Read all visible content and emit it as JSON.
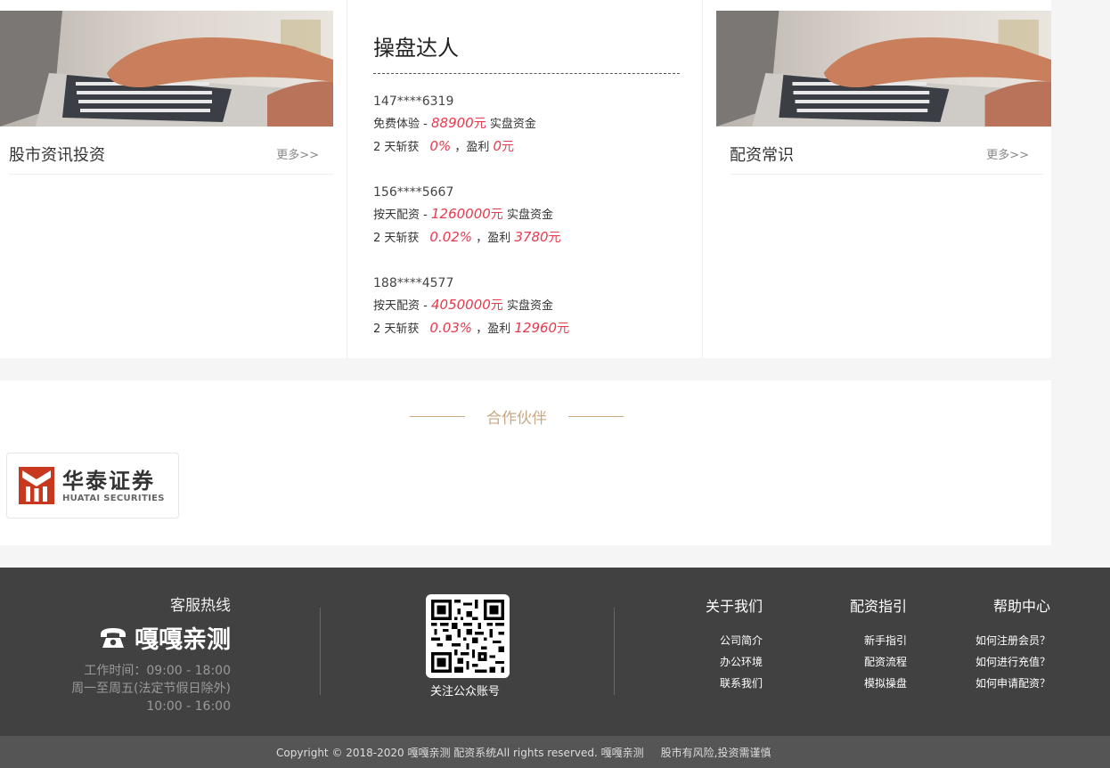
{
  "left_column": {
    "title": "股市资讯投资",
    "more": "更多>>"
  },
  "right_column": {
    "title": "配资常识",
    "more": "更多>>"
  },
  "experts": {
    "title": "操盘达人",
    "trades": [
      {
        "phone": "147****6319",
        "type": "免费体验",
        "amount": "88900",
        "unit": "元",
        "amount_suffix": "实盘资金",
        "days": "2 天斩获",
        "rate": "0%",
        "profit_label": "，盈利",
        "profit": "0",
        "profit_unit": "元"
      },
      {
        "phone": "156****5667",
        "type": "按天配资",
        "amount": "1260000",
        "unit": "元",
        "amount_suffix": "实盘资金",
        "days": "2 天斩获",
        "rate": "0.02%",
        "profit_label": "，盈利",
        "profit": "3780",
        "profit_unit": "元"
      },
      {
        "phone": "188****4577",
        "type": "按天配资",
        "amount": "4050000",
        "unit": "元",
        "amount_suffix": "实盘资金",
        "days": "2 天斩获",
        "rate": "0.03%",
        "profit_label": "，盈利",
        "profit": "12960",
        "profit_unit": "元"
      }
    ]
  },
  "partners": {
    "title": "合作伙伴",
    "items": [
      {
        "name_cn": "华泰证券",
        "name_en": "HUATAI SECURITIES"
      }
    ]
  },
  "footer": {
    "hotline_label": "客服热线",
    "hotline_name": "嘎嘎亲测",
    "hours": [
      "工作时间：09:00 - 18:00",
      "周一至周五(法定节假日除外)",
      "10:00 - 16:00"
    ],
    "qr_caption": "关注公众账号",
    "columns": [
      {
        "title": "关于我们",
        "links": [
          "公司简介",
          "办公环境",
          "联系我们"
        ]
      },
      {
        "title": "配资指引",
        "links": [
          "新手指引",
          "配资流程",
          "模拟操盘"
        ]
      },
      {
        "title": "帮助中心",
        "links": [
          "如何注册会员？",
          "如何进行充值？",
          "如何申请配资？"
        ]
      }
    ],
    "copyright": "Copyright © 2018-2020 嘎嘎亲测 配资系统All rights reserved. 嘎嘎亲测     股市有风险,投资需谨慎"
  },
  "colors": {
    "accent_red": "#e8394d",
    "partner_gold": "#c9a882",
    "footer_bg": "#414141",
    "logo_red": "#c8381e"
  }
}
